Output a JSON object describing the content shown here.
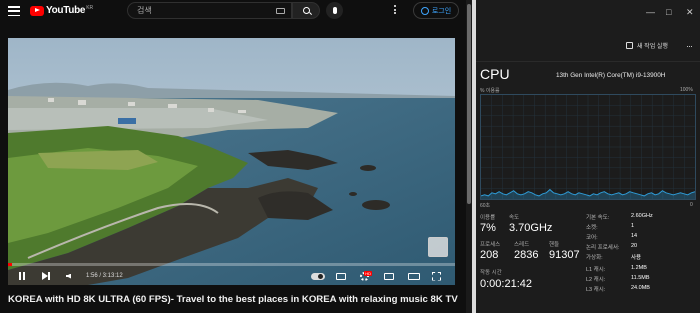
{
  "youtube": {
    "logo_text": "YouTube",
    "logo_region": "KR",
    "search_placeholder": "검색",
    "login_label": "로그인",
    "video": {
      "current_time": "1:56 / 3:13:12",
      "progress": 0.01,
      "title": "KOREA with HD 8K ULTRA (60 FPS)- Travel to the best places in KOREA with relaxing music 8K TV"
    }
  },
  "task_manager": {
    "new_task_label": "새 작업 실행",
    "more_label": "···",
    "cpu_heading": "CPU",
    "cpu_model": "13th Gen Intel(R) Core(TM) i9-13900H",
    "usage_label": "% 이용률",
    "max_label": "100%",
    "seconds_label": "60초",
    "zero_label": "0",
    "stats": {
      "utilization_label": "이용률",
      "utilization_value": "7%",
      "speed_label": "속도",
      "speed_value": "3.70GHz",
      "processes_label": "프로세스",
      "processes_value": "208",
      "threads_label": "스레드",
      "threads_value": "2836",
      "handles_label": "핸들",
      "handles_value": "91307",
      "uptime_label": "작동 시간",
      "uptime_value": "0:00:21:42"
    },
    "specs": [
      {
        "key": "기본 속도:",
        "value": "2.60GHz"
      },
      {
        "key": "소켓:",
        "value": "1"
      },
      {
        "key": "코어:",
        "value": "14"
      },
      {
        "key": "논리 프로세서:",
        "value": "20"
      },
      {
        "key": "가상화:",
        "value": "사용"
      },
      {
        "key": "L1 캐시:",
        "value": "1.2MB"
      },
      {
        "key": "L2 캐시:",
        "value": "11.5MB"
      },
      {
        "key": "L3 캐시:",
        "value": "24.0MB"
      }
    ],
    "graph_values": [
      3,
      4,
      3,
      6,
      5,
      7,
      5,
      4,
      6,
      8,
      5,
      4,
      5,
      7,
      6,
      4,
      3,
      5,
      6,
      9,
      6,
      5,
      4,
      5,
      7,
      5,
      4,
      6,
      5,
      4,
      3,
      5,
      4,
      6,
      7,
      5,
      4,
      5,
      6,
      4,
      5,
      7,
      6,
      5,
      4,
      3,
      5,
      6,
      4,
      5,
      8,
      6,
      5,
      4,
      5,
      6,
      5,
      4,
      6,
      7
    ],
    "accent": "#2e9bd6"
  }
}
